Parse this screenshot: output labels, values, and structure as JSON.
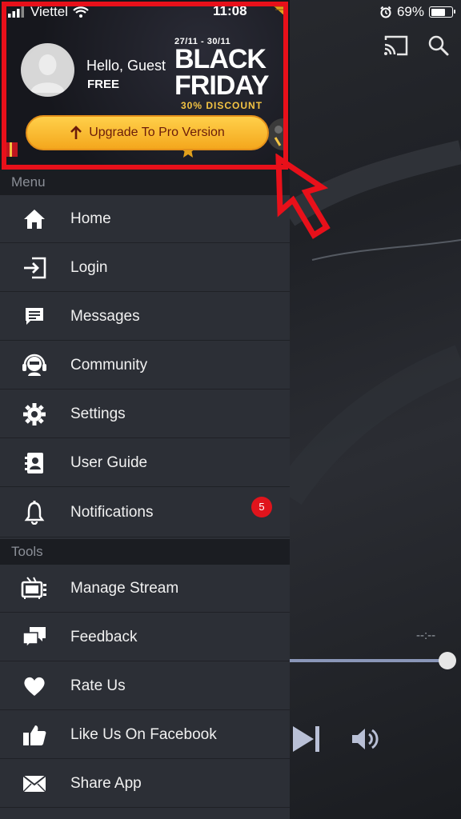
{
  "status": {
    "carrier": "Viettel",
    "time": "11:08",
    "battery_pct": "69%"
  },
  "header": {
    "greeting": "Hello, Guest",
    "plan": "FREE",
    "promo": {
      "dates": "27/11 - 30/11",
      "line1": "BLACK",
      "line2": "FRIDAY",
      "discount": "30% DISCOUNT"
    },
    "upgrade_label": "Upgrade To Pro Version"
  },
  "menu": {
    "title": "Menu",
    "items": [
      {
        "label": "Home",
        "icon": "home-icon"
      },
      {
        "label": "Login",
        "icon": "login-icon"
      },
      {
        "label": "Messages",
        "icon": "message-icon"
      },
      {
        "label": "Community",
        "icon": "community-icon"
      },
      {
        "label": "Settings",
        "icon": "gear-icon"
      },
      {
        "label": "User Guide",
        "icon": "contacts-book-icon"
      },
      {
        "label": "Notifications",
        "icon": "bell-icon",
        "badge": "5"
      }
    ]
  },
  "tools": {
    "title": "Tools",
    "items": [
      {
        "label": "Manage Stream",
        "icon": "tv-icon"
      },
      {
        "label": "Feedback",
        "icon": "chat-bubbles-icon"
      },
      {
        "label": "Rate Us",
        "icon": "heart-icon"
      },
      {
        "label": "Like Us On Facebook",
        "icon": "thumbs-up-icon"
      },
      {
        "label": "Share App",
        "icon": "envelope-icon"
      }
    ]
  },
  "player": {
    "time": "--:--"
  },
  "colors": {
    "highlight": "#e8101a",
    "badge": "#e0141c",
    "upgrade_button": "#f6b92a"
  }
}
